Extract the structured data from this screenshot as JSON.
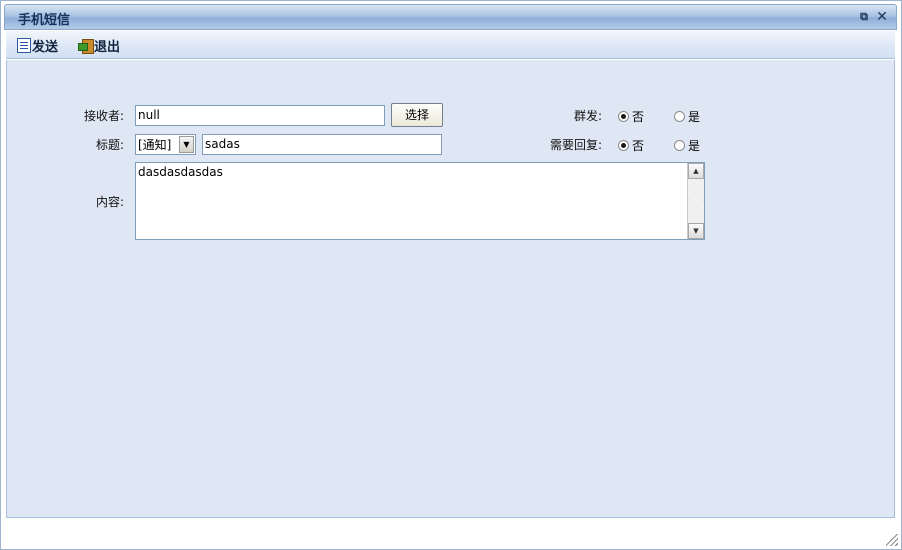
{
  "window": {
    "title": "手机短信",
    "popout_glyph": "⧉",
    "close_glyph": "✕"
  },
  "toolbar": {
    "send_label": "发送",
    "exit_label": "退出",
    "send_icon": "save-icon",
    "exit_icon": "exit-icon"
  },
  "form": {
    "receiver_label": "接收者:",
    "receiver_value": "null",
    "select_button_label": "选择",
    "title_label": "标题:",
    "category_selected": "[通知]",
    "subject_value": "sadas",
    "content_label": "内容:",
    "content_value": "dasdasdasdas",
    "group_send_label": "群发:",
    "group_send_no": "否",
    "group_send_yes": "是",
    "group_send_selected": "否",
    "need_reply_label": "需要回复:",
    "need_reply_no": "否",
    "need_reply_yes": "是",
    "need_reply_selected": "否"
  }
}
